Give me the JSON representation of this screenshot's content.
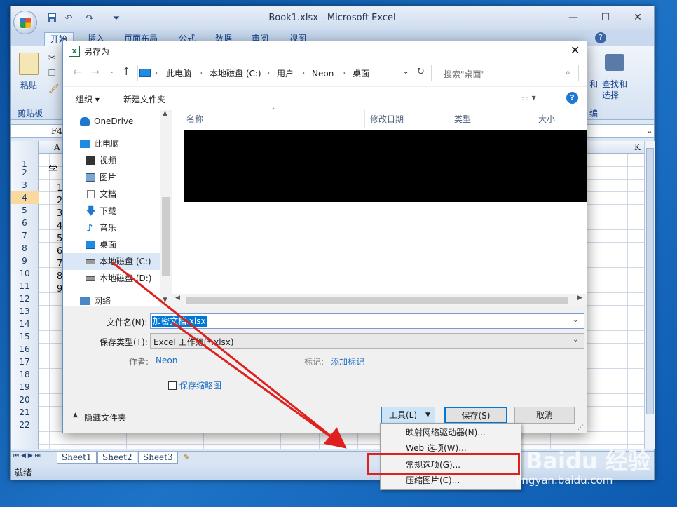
{
  "excel": {
    "title": "Book1.xlsx - Microsoft Excel",
    "tabs": [
      "开始",
      "插入",
      "页面布局",
      "公式",
      "数据",
      "审阅",
      "视图"
    ],
    "ribbon": {
      "paste": "粘贴",
      "clipboard": "剪贴板",
      "find_select": "查找和",
      "find_select2": "选择",
      "edit_group": "编",
      "edit_group_left": "和"
    },
    "name_box": "F4",
    "columns": [
      "A",
      "K"
    ],
    "row_numbers": [
      "1",
      "2",
      "3",
      "4",
      "5",
      "6",
      "7",
      "8",
      "9",
      "10",
      "11",
      "12",
      "13",
      "14",
      "15",
      "16",
      "17",
      "18",
      "19",
      "20",
      "21",
      "22"
    ],
    "cells": {
      "a1": "学",
      "a2": "1",
      "a3": "2",
      "a4": "3",
      "a5": "4",
      "a6": "5",
      "a7": "6",
      "a8": "7",
      "a9": "8",
      "a10": "9"
    },
    "sheets": [
      "Sheet1",
      "Sheet2",
      "Sheet3"
    ],
    "status": "就绪"
  },
  "dialog": {
    "title": "另存为",
    "breadcrumb": [
      "此电脑",
      "本地磁盘 (C:)",
      "用户",
      "Neon",
      "桌面"
    ],
    "search_placeholder": "搜索\"桌面\"",
    "organize": "组织 ▾",
    "new_folder": "新建文件夹",
    "nav": [
      "OneDrive",
      "此电脑",
      "视频",
      "图片",
      "文档",
      "下载",
      "音乐",
      "桌面",
      "本地磁盘 (C:)",
      "本地磁盘 (D:)",
      "网络"
    ],
    "columns": [
      "名称",
      "修改日期",
      "类型",
      "大小"
    ],
    "filename_label": "文件名(N):",
    "filename": "加密文档.xlsx",
    "filetype_label": "保存类型(T):",
    "filetype": "Excel 工作簿(*.xlsx)",
    "author_label": "作者:",
    "author": "Neon",
    "tags_label": "标记:",
    "tags": "添加标记",
    "thumbnail": "保存缩略图",
    "hide_folders": "隐藏文件夹",
    "tools": "工具(L)",
    "save": "保存(S)",
    "cancel": "取消"
  },
  "tools_menu": [
    "映射网络驱动器(N)...",
    "Web 选项(W)...",
    "常规选项(G)...",
    "压缩图片(C)..."
  ],
  "watermark": {
    "brand": "Baidu 经验",
    "url": "jingyan.baidu.com"
  },
  "colors": {
    "highlight": "#e01f1f",
    "selection": "#0078d7",
    "accent": "#15428b"
  }
}
